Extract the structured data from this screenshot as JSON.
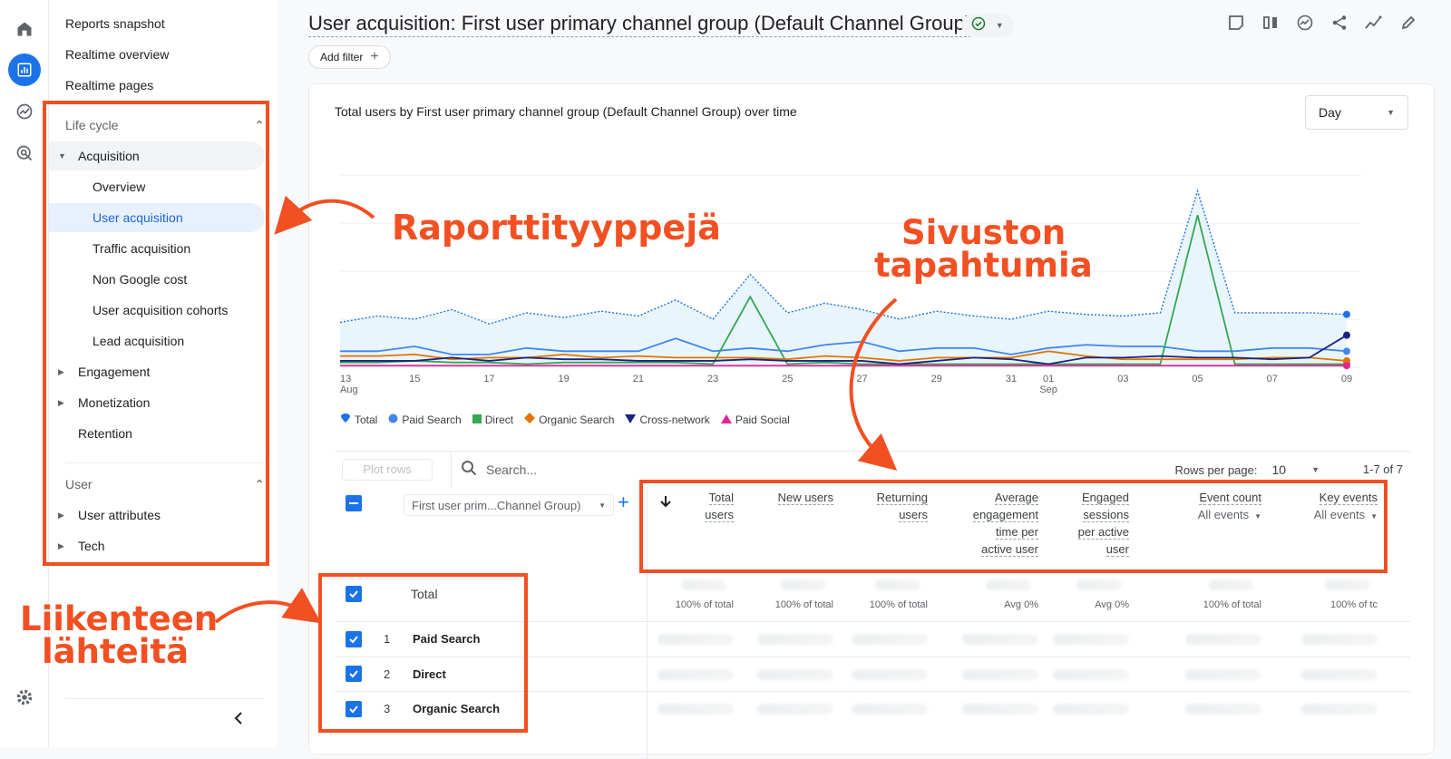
{
  "nav": {
    "top_items": [
      "Reports snapshot",
      "Realtime overview",
      "Realtime pages"
    ],
    "lifecycle_label": "Life cycle",
    "acquisition_label": "Acquisition",
    "acquisition_items": [
      "Overview",
      "User acquisition",
      "Traffic acquisition",
      "Non Google cost",
      "User acquisition cohorts",
      "Lead acquisition"
    ],
    "engagement_label": "Engagement",
    "monetization_label": "Monetization",
    "retention_label": "Retention",
    "user_label": "User",
    "user_attributes_label": "User attributes",
    "tech_label": "Tech"
  },
  "header": {
    "title": "User acquisition: First user primary channel group (Default Channel Group)",
    "add_filter": "Add filter"
  },
  "chart": {
    "title": "Total users by First user primary channel group (Default Channel Group) over time",
    "granularity": "Day",
    "x_ticks": [
      "13",
      "15",
      "17",
      "19",
      "21",
      "23",
      "25",
      "27",
      "29",
      "31",
      "01",
      "03",
      "05",
      "07",
      "09"
    ],
    "x_month_labels": {
      "13": "Aug",
      "01": "Sep"
    },
    "legend": [
      {
        "name": "Total",
        "color": "#1a73e8",
        "marker": "pin-icon"
      },
      {
        "name": "Paid Search",
        "color": "#4285f4",
        "marker": "circle-icon"
      },
      {
        "name": "Direct",
        "color": "#34a853",
        "marker": "square-icon"
      },
      {
        "name": "Organic Search",
        "color": "#e37400",
        "marker": "diamond-icon"
      },
      {
        "name": "Cross-network",
        "color": "#1a237e",
        "marker": "triangle-down-icon"
      },
      {
        "name": "Paid Social",
        "color": "#e52592",
        "marker": "triangle-up-icon"
      }
    ]
  },
  "chart_data": {
    "type": "line",
    "title": "Total users by First user primary channel group (Default Channel Group) over time",
    "x": [
      "Aug 13",
      "Aug 14",
      "Aug 15",
      "Aug 16",
      "Aug 17",
      "Aug 18",
      "Aug 19",
      "Aug 20",
      "Aug 21",
      "Aug 22",
      "Aug 23",
      "Aug 24",
      "Aug 25",
      "Aug 26",
      "Aug 27",
      "Aug 28",
      "Aug 29",
      "Aug 30",
      "Aug 31",
      "Sep 01",
      "Sep 02",
      "Sep 03",
      "Sep 04",
      "Sep 05",
      "Sep 06",
      "Sep 07",
      "Sep 08",
      "Sep 09"
    ],
    "series": [
      {
        "name": "Total",
        "values": [
          28,
          32,
          30,
          36,
          27,
          34,
          31,
          35,
          32,
          42,
          30,
          58,
          34,
          40,
          36,
          30,
          35,
          32,
          30,
          35,
          33,
          32,
          34,
          110,
          34,
          34,
          34,
          33
        ]
      },
      {
        "name": "Paid Search",
        "values": [
          10,
          10,
          13,
          8,
          8,
          12,
          10,
          10,
          10,
          18,
          10,
          12,
          10,
          14,
          16,
          10,
          12,
          12,
          8,
          12,
          14,
          13,
          13,
          10,
          10,
          12,
          12,
          10
        ]
      },
      {
        "name": "Direct",
        "values": [
          3,
          3,
          4,
          3,
          3,
          2,
          3,
          3,
          3,
          3,
          2,
          44,
          2,
          3,
          2,
          2,
          2,
          2,
          2,
          2,
          2,
          2,
          2,
          95,
          2,
          2,
          2,
          2
        ]
      },
      {
        "name": "Organic Search",
        "values": [
          7,
          7,
          8,
          5,
          6,
          6,
          8,
          6,
          7,
          6,
          6,
          6,
          5,
          7,
          6,
          4,
          6,
          6,
          6,
          10,
          7,
          5,
          5,
          5,
          5,
          6,
          6,
          4
        ]
      },
      {
        "name": "Cross-network",
        "values": [
          4,
          4,
          4,
          6,
          4,
          6,
          5,
          5,
          4,
          4,
          4,
          5,
          4,
          4,
          4,
          2,
          4,
          6,
          5,
          2,
          6,
          6,
          7,
          6,
          6,
          5,
          6,
          20
        ]
      },
      {
        "name": "Paid Social",
        "values": [
          1,
          1,
          1,
          1,
          1,
          1,
          1,
          1,
          1,
          1,
          1,
          1,
          1,
          1,
          1,
          1,
          1,
          1,
          1,
          1,
          1,
          1,
          1,
          1,
          1,
          1,
          1,
          1
        ]
      }
    ],
    "grid": true,
    "legend_position": "bottom"
  },
  "table": {
    "plot_rows": "Plot rows",
    "search_placeholder": "Search...",
    "rows_per_page_label": "Rows per page:",
    "rows_per_page_value": "10",
    "pagination": "1-7 of 7",
    "dimension_label": "First user prim...Channel Group)",
    "columns": [
      {
        "l1": "Total",
        "l2": "users",
        "l3": "",
        "l4": "",
        "pct": "100% of total"
      },
      {
        "l1": "New users",
        "l2": "",
        "l3": "",
        "l4": "",
        "pct": "100% of total"
      },
      {
        "l1": "Returning",
        "l2": "users",
        "l3": "",
        "l4": "",
        "pct": "100% of total"
      },
      {
        "l1": "Average",
        "l2": "engagement",
        "l3": "time per",
        "l4": "active user",
        "pct": "Avg 0%"
      },
      {
        "l1": "Engaged",
        "l2": "sessions",
        "l3": "per active",
        "l4": "user",
        "pct": "Avg 0%"
      },
      {
        "l1": "Event count",
        "l2": "All events",
        "l3": "",
        "l4": "",
        "pct": "100% of total"
      },
      {
        "l1": "Key events",
        "l2": "All events",
        "l3": "",
        "l4": "",
        "pct": "100% of tc"
      }
    ],
    "total_label": "Total",
    "rows": [
      {
        "num": "1",
        "name": "Paid Search"
      },
      {
        "num": "2",
        "name": "Direct"
      },
      {
        "num": "3",
        "name": "Organic Search"
      }
    ]
  },
  "annotations": {
    "report_types": "Raporttityyppejä",
    "site_events_1": "Sivuston",
    "site_events_2": "tapahtumia",
    "traffic_sources_1": "Liikenteen",
    "traffic_sources_2": "lähteitä",
    "color": "#f25022"
  }
}
